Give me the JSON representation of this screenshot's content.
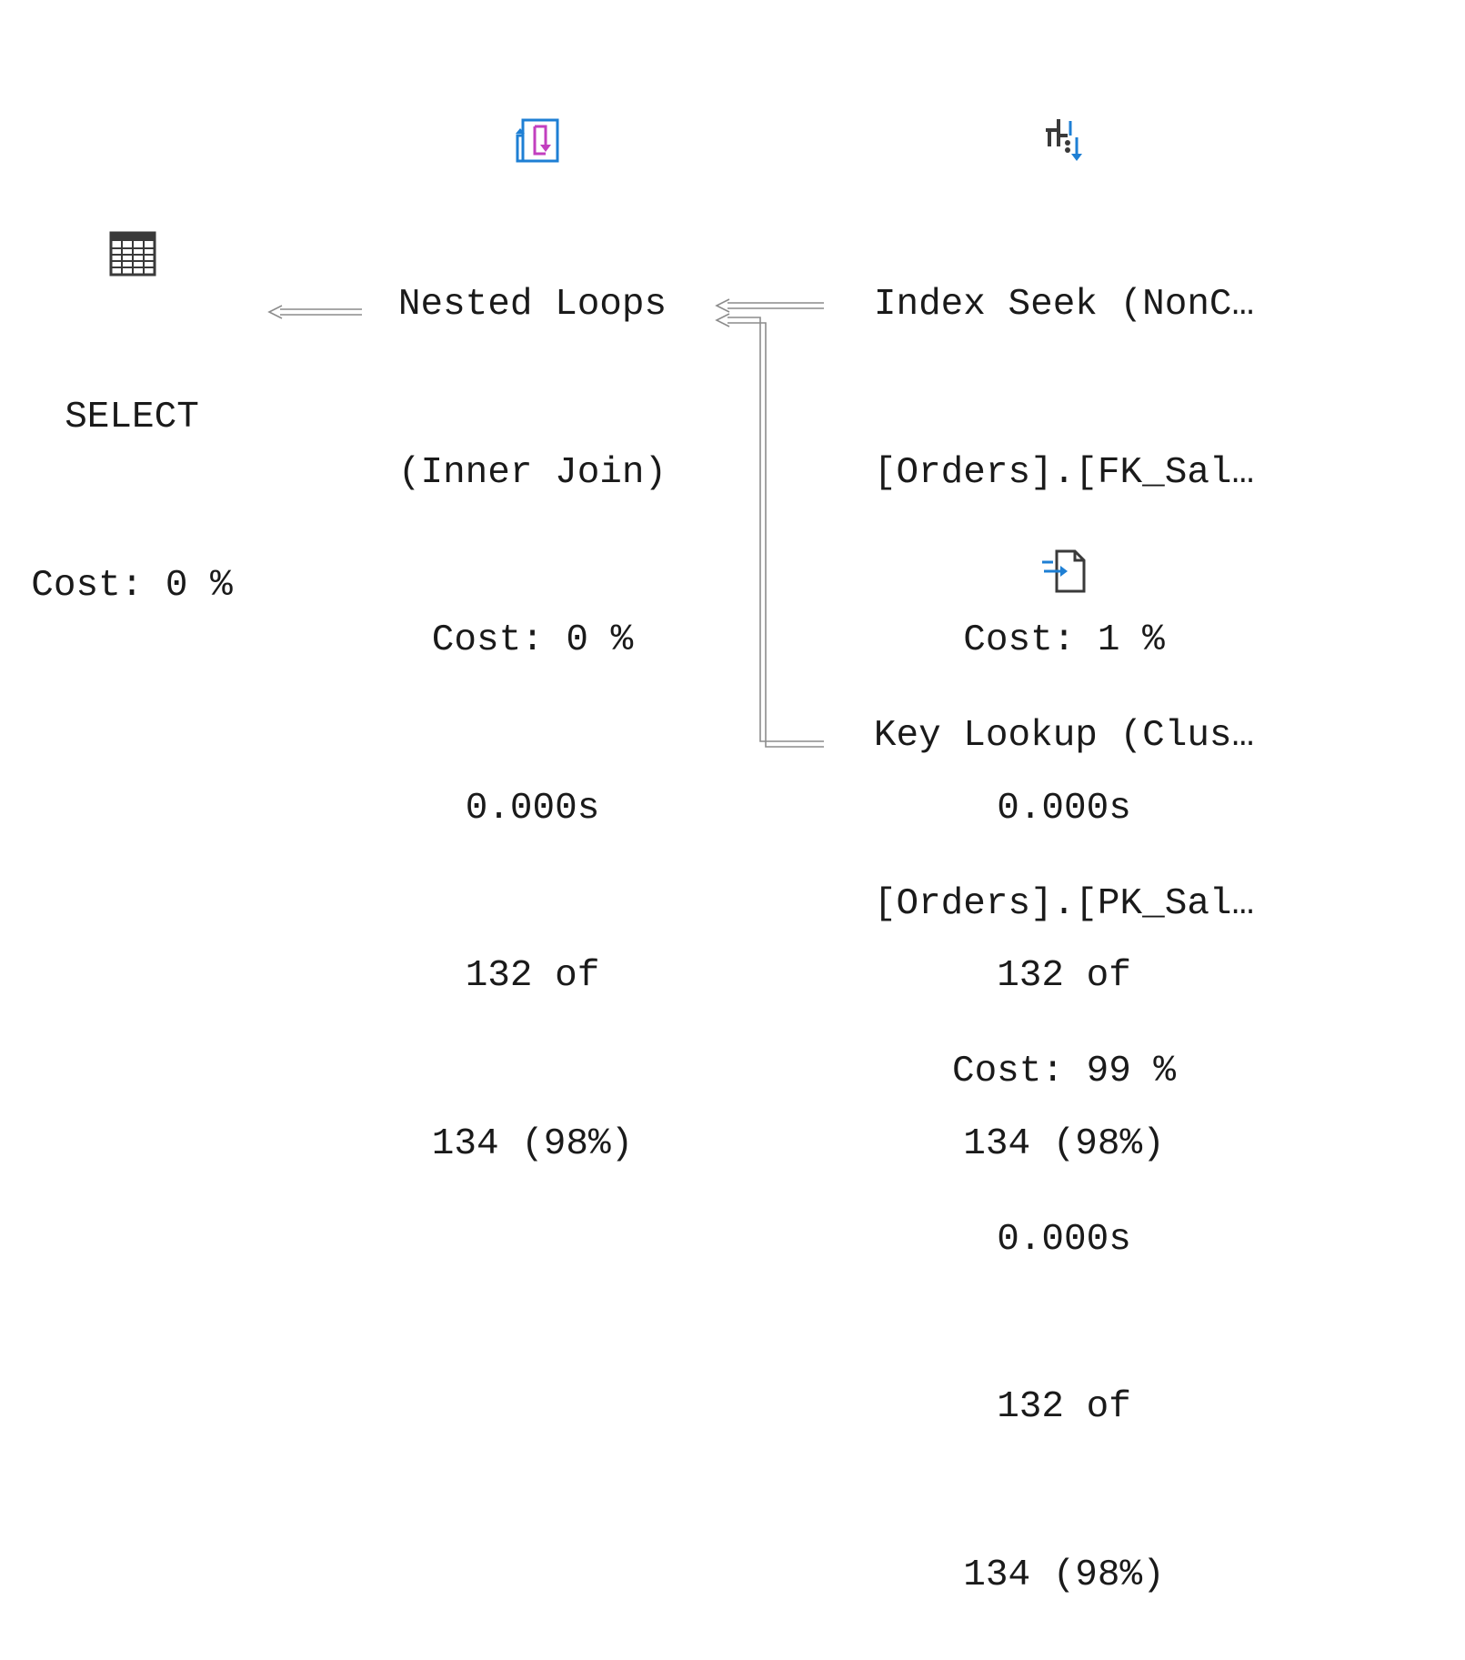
{
  "plan": {
    "nodes": [
      {
        "id": "select",
        "icon": "result-table-icon",
        "lines": [
          "SELECT",
          "Cost: 0 %"
        ]
      },
      {
        "id": "nested_loops",
        "icon": "nested-loops-icon",
        "lines": [
          "Nested Loops",
          "(Inner Join)",
          "Cost: 0 %",
          "0.000s",
          "132 of",
          "134 (98%)"
        ]
      },
      {
        "id": "index_seek",
        "icon": "index-seek-icon",
        "lines": [
          "Index Seek (NonC…",
          "[Orders].[FK_Sal…",
          "Cost: 1 %",
          "0.000s",
          "132 of",
          "134 (98%)"
        ]
      },
      {
        "id": "key_lookup",
        "icon": "key-lookup-icon",
        "lines": [
          "Key Lookup (Clus…",
          "[Orders].[PK_Sal…",
          "Cost: 99 %",
          "0.000s",
          "132 of",
          "134 (98%)"
        ]
      }
    ],
    "colors": {
      "text": "#1a1a1a",
      "connector": "#8c8c8c",
      "icon_blue": "#1e7fd4",
      "icon_magenta": "#c23fbf",
      "icon_dark": "#3a3a3a"
    }
  }
}
